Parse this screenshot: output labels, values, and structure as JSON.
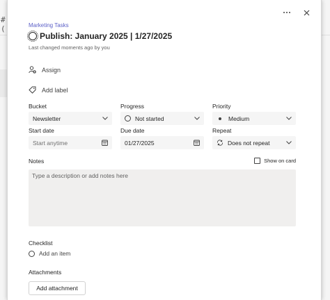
{
  "background": {
    "strip_text": "# ("
  },
  "header": {
    "plan_name": "Marketing Tasks",
    "title": "Publish: January 2025 | 1/27/2025",
    "last_changed": "Last changed moments ago by you",
    "more_icon": "more-horizontal-icon",
    "close_icon": "close-icon"
  },
  "assign": {
    "label": "Assign",
    "icon": "person-add-icon"
  },
  "add_label": {
    "label": "Add label",
    "icon": "tag-icon"
  },
  "fields": {
    "bucket": {
      "label": "Bucket",
      "value": "Newsletter"
    },
    "progress": {
      "label": "Progress",
      "value": "Not started"
    },
    "priority": {
      "label": "Priority",
      "value": "Medium"
    },
    "start_date": {
      "label": "Start date",
      "placeholder": "Start anytime"
    },
    "due_date": {
      "label": "Due date",
      "value": "01/27/2025"
    },
    "repeat": {
      "label": "Repeat",
      "value": "Does not repeat"
    }
  },
  "notes": {
    "label": "Notes",
    "show_on_card": "Show on card",
    "placeholder": "Type a description or add notes here"
  },
  "checklist": {
    "label": "Checklist",
    "add_item": "Add an item"
  },
  "attachments": {
    "label": "Attachments",
    "add_button": "Add attachment"
  },
  "colors": {
    "plan_link": "#5b5fc7",
    "field_bg": "#f5f5f5",
    "notes_bg": "#f0efee"
  }
}
